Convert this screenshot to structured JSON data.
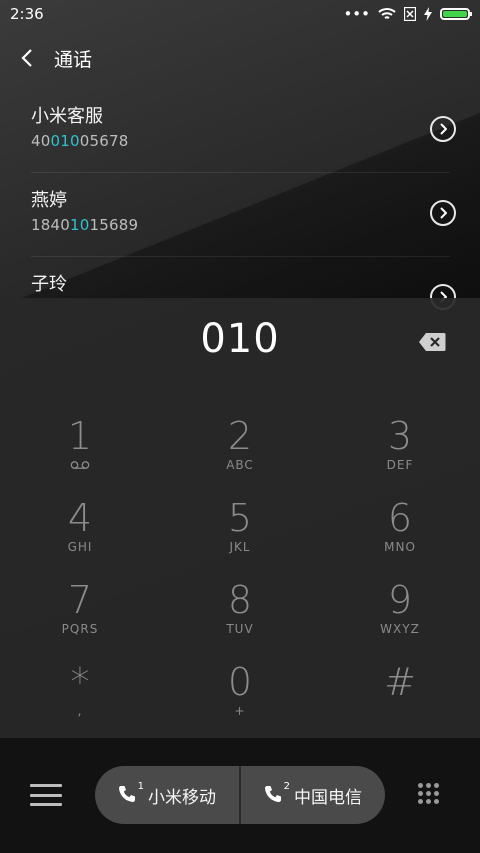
{
  "status_bar": {
    "time": "2:36",
    "icons": [
      "more-dots-icon",
      "wifi-icon",
      "no-sim-icon",
      "charging-icon",
      "battery-icon"
    ]
  },
  "header": {
    "title": "通话",
    "back_icon": "chevron-left-icon"
  },
  "contacts": [
    {
      "name": "小米客服",
      "number_prefix": "40",
      "number_match": "010",
      "number_suffix": "05678"
    },
    {
      "name": "燕婷",
      "number_prefix": "1840",
      "number_match": "10",
      "number_suffix": "15689"
    },
    {
      "name": "子玲",
      "number_prefix": "",
      "number_match": "",
      "number_suffix": ""
    }
  ],
  "dialer": {
    "input_value": "010",
    "keys": [
      {
        "digit": "1",
        "sub": "voicemail"
      },
      {
        "digit": "2",
        "sub": "ABC"
      },
      {
        "digit": "3",
        "sub": "DEF"
      },
      {
        "digit": "4",
        "sub": "GHI"
      },
      {
        "digit": "5",
        "sub": "JKL"
      },
      {
        "digit": "6",
        "sub": "MNO"
      },
      {
        "digit": "7",
        "sub": "PQRS"
      },
      {
        "digit": "8",
        "sub": "TUV"
      },
      {
        "digit": "9",
        "sub": "WXYZ"
      },
      {
        "digit": "*",
        "sub": ","
      },
      {
        "digit": "0",
        "sub": "+"
      },
      {
        "digit": "#",
        "sub": ""
      }
    ]
  },
  "bottom_bar": {
    "sim1_label": "小米移动",
    "sim1_index": "1",
    "sim2_label": "中国电信",
    "sim2_index": "2"
  },
  "colors": {
    "match_highlight": "#2bc4cf",
    "battery": "#3fd44a"
  }
}
